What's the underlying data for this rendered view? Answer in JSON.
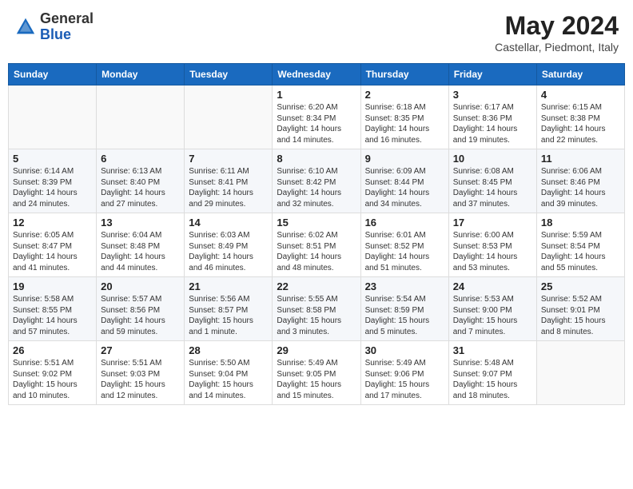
{
  "header": {
    "logo_general": "General",
    "logo_blue": "Blue",
    "month_title": "May 2024",
    "subtitle": "Castellar, Piedmont, Italy"
  },
  "days_of_week": [
    "Sunday",
    "Monday",
    "Tuesday",
    "Wednesday",
    "Thursday",
    "Friday",
    "Saturday"
  ],
  "weeks": [
    [
      {
        "day": "",
        "text": ""
      },
      {
        "day": "",
        "text": ""
      },
      {
        "day": "",
        "text": ""
      },
      {
        "day": "1",
        "text": "Sunrise: 6:20 AM\nSunset: 8:34 PM\nDaylight: 14 hours\nand 14 minutes."
      },
      {
        "day": "2",
        "text": "Sunrise: 6:18 AM\nSunset: 8:35 PM\nDaylight: 14 hours\nand 16 minutes."
      },
      {
        "day": "3",
        "text": "Sunrise: 6:17 AM\nSunset: 8:36 PM\nDaylight: 14 hours\nand 19 minutes."
      },
      {
        "day": "4",
        "text": "Sunrise: 6:15 AM\nSunset: 8:38 PM\nDaylight: 14 hours\nand 22 minutes."
      }
    ],
    [
      {
        "day": "5",
        "text": "Sunrise: 6:14 AM\nSunset: 8:39 PM\nDaylight: 14 hours\nand 24 minutes."
      },
      {
        "day": "6",
        "text": "Sunrise: 6:13 AM\nSunset: 8:40 PM\nDaylight: 14 hours\nand 27 minutes."
      },
      {
        "day": "7",
        "text": "Sunrise: 6:11 AM\nSunset: 8:41 PM\nDaylight: 14 hours\nand 29 minutes."
      },
      {
        "day": "8",
        "text": "Sunrise: 6:10 AM\nSunset: 8:42 PM\nDaylight: 14 hours\nand 32 minutes."
      },
      {
        "day": "9",
        "text": "Sunrise: 6:09 AM\nSunset: 8:44 PM\nDaylight: 14 hours\nand 34 minutes."
      },
      {
        "day": "10",
        "text": "Sunrise: 6:08 AM\nSunset: 8:45 PM\nDaylight: 14 hours\nand 37 minutes."
      },
      {
        "day": "11",
        "text": "Sunrise: 6:06 AM\nSunset: 8:46 PM\nDaylight: 14 hours\nand 39 minutes."
      }
    ],
    [
      {
        "day": "12",
        "text": "Sunrise: 6:05 AM\nSunset: 8:47 PM\nDaylight: 14 hours\nand 41 minutes."
      },
      {
        "day": "13",
        "text": "Sunrise: 6:04 AM\nSunset: 8:48 PM\nDaylight: 14 hours\nand 44 minutes."
      },
      {
        "day": "14",
        "text": "Sunrise: 6:03 AM\nSunset: 8:49 PM\nDaylight: 14 hours\nand 46 minutes."
      },
      {
        "day": "15",
        "text": "Sunrise: 6:02 AM\nSunset: 8:51 PM\nDaylight: 14 hours\nand 48 minutes."
      },
      {
        "day": "16",
        "text": "Sunrise: 6:01 AM\nSunset: 8:52 PM\nDaylight: 14 hours\nand 51 minutes."
      },
      {
        "day": "17",
        "text": "Sunrise: 6:00 AM\nSunset: 8:53 PM\nDaylight: 14 hours\nand 53 minutes."
      },
      {
        "day": "18",
        "text": "Sunrise: 5:59 AM\nSunset: 8:54 PM\nDaylight: 14 hours\nand 55 minutes."
      }
    ],
    [
      {
        "day": "19",
        "text": "Sunrise: 5:58 AM\nSunset: 8:55 PM\nDaylight: 14 hours\nand 57 minutes."
      },
      {
        "day": "20",
        "text": "Sunrise: 5:57 AM\nSunset: 8:56 PM\nDaylight: 14 hours\nand 59 minutes."
      },
      {
        "day": "21",
        "text": "Sunrise: 5:56 AM\nSunset: 8:57 PM\nDaylight: 15 hours\nand 1 minute."
      },
      {
        "day": "22",
        "text": "Sunrise: 5:55 AM\nSunset: 8:58 PM\nDaylight: 15 hours\nand 3 minutes."
      },
      {
        "day": "23",
        "text": "Sunrise: 5:54 AM\nSunset: 8:59 PM\nDaylight: 15 hours\nand 5 minutes."
      },
      {
        "day": "24",
        "text": "Sunrise: 5:53 AM\nSunset: 9:00 PM\nDaylight: 15 hours\nand 7 minutes."
      },
      {
        "day": "25",
        "text": "Sunrise: 5:52 AM\nSunset: 9:01 PM\nDaylight: 15 hours\nand 8 minutes."
      }
    ],
    [
      {
        "day": "26",
        "text": "Sunrise: 5:51 AM\nSunset: 9:02 PM\nDaylight: 15 hours\nand 10 minutes."
      },
      {
        "day": "27",
        "text": "Sunrise: 5:51 AM\nSunset: 9:03 PM\nDaylight: 15 hours\nand 12 minutes."
      },
      {
        "day": "28",
        "text": "Sunrise: 5:50 AM\nSunset: 9:04 PM\nDaylight: 15 hours\nand 14 minutes."
      },
      {
        "day": "29",
        "text": "Sunrise: 5:49 AM\nSunset: 9:05 PM\nDaylight: 15 hours\nand 15 minutes."
      },
      {
        "day": "30",
        "text": "Sunrise: 5:49 AM\nSunset: 9:06 PM\nDaylight: 15 hours\nand 17 minutes."
      },
      {
        "day": "31",
        "text": "Sunrise: 5:48 AM\nSunset: 9:07 PM\nDaylight: 15 hours\nand 18 minutes."
      },
      {
        "day": "",
        "text": ""
      }
    ]
  ]
}
